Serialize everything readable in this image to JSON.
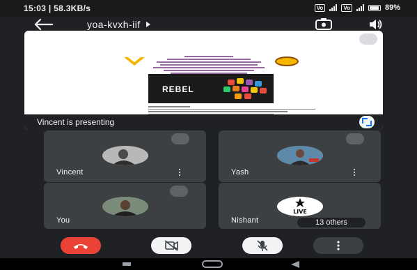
{
  "status_bar": {
    "time_speed": "15:03 | 58.3KB/s",
    "battery": "89%"
  },
  "top_bar": {
    "meeting_code": "yoa-kvxh-iif",
    "icons": [
      "back-arrow-icon",
      "chevron-right-icon",
      "switch-camera-icon",
      "speaker-icon"
    ]
  },
  "presentation": {
    "label": "Vincent is presenting",
    "slide_banner_text": "REBEL"
  },
  "participants": [
    {
      "name": "Vincent",
      "muted": true
    },
    {
      "name": "Yash",
      "muted": true
    },
    {
      "name": "You",
      "muted": true
    },
    {
      "name": "Nishant",
      "muted": false,
      "others_label": "13 others",
      "avatar_text": "LIVE"
    }
  ],
  "controls": {
    "icons": [
      "end-call-icon",
      "camera-off-icon",
      "mic-off-icon",
      "more-options-icon"
    ]
  },
  "colors": {
    "background": "#202124",
    "tile": "#3c4043",
    "end_call": "#ea4335",
    "accent": "#1a73e8"
  }
}
